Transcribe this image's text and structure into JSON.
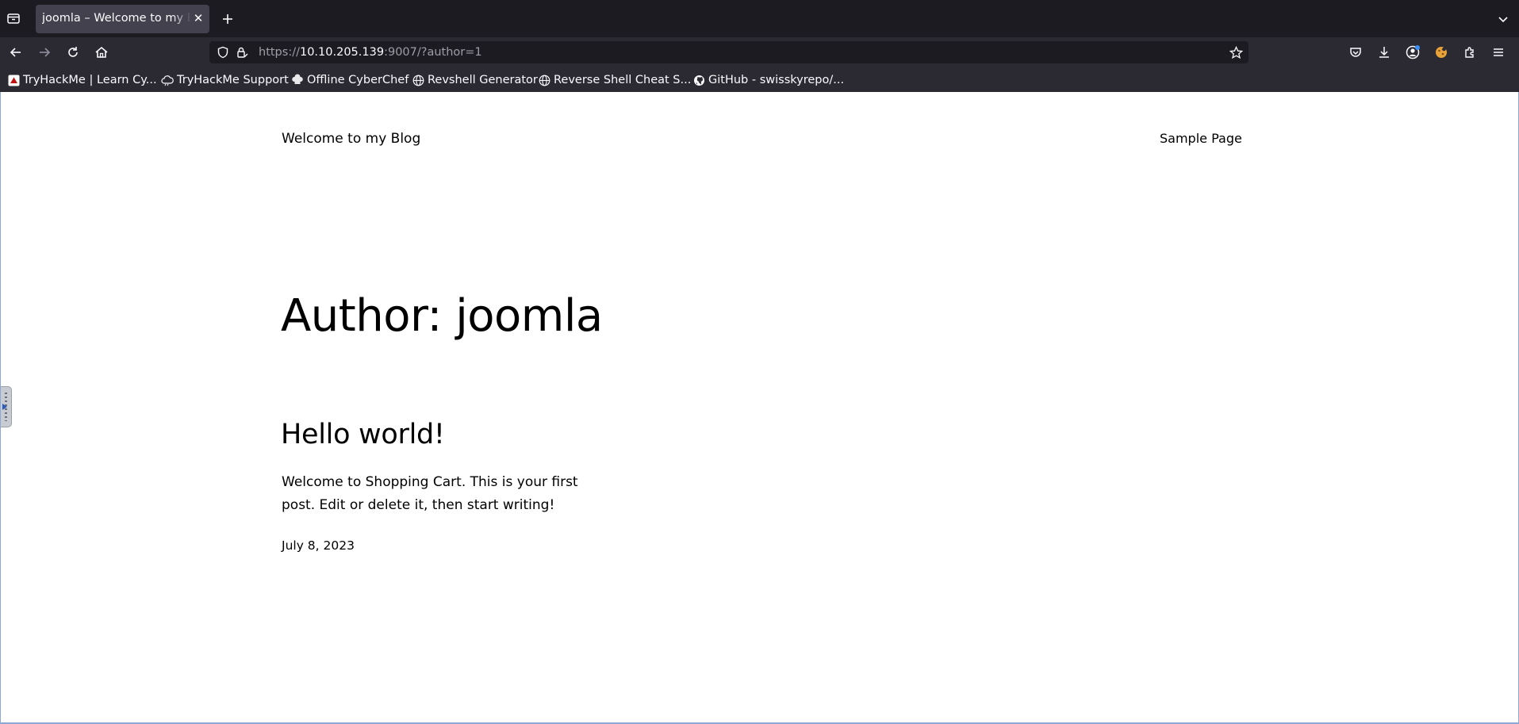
{
  "browser": {
    "tab": {
      "title": "joomla – Welcome to my Blog"
    },
    "url": {
      "scheme": "https://",
      "host": "10.10.205.139",
      "rest": ":9007/?author=1"
    },
    "bookmarks": [
      {
        "label": "TryHackMe | Learn Cy...",
        "icon": "tryhackme-icon"
      },
      {
        "label": "TryHackMe Support",
        "icon": "cloud-icon"
      },
      {
        "label": "Offline CyberChef",
        "icon": "chef-hat-icon"
      },
      {
        "label": "Revshell Generator",
        "icon": "globe-icon"
      },
      {
        "label": "Reverse Shell Cheat S...",
        "icon": "globe-icon"
      },
      {
        "label": "GitHub - swisskyrepo/...",
        "icon": "github-icon"
      }
    ],
    "colors": {
      "chrome_dark": "#1c1b22",
      "toolbar": "#2b2a33",
      "tab_active": "#42414d"
    }
  },
  "site": {
    "title": "Welcome to my Blog",
    "nav": {
      "sample_page": "Sample Page"
    }
  },
  "archive": {
    "title": "Author: joomla"
  },
  "post": {
    "title": "Hello world!",
    "excerpt": "Welcome to Shopping Cart. This is your first post. Edit or delete it, then start writing!",
    "date": "July 8, 2023"
  }
}
